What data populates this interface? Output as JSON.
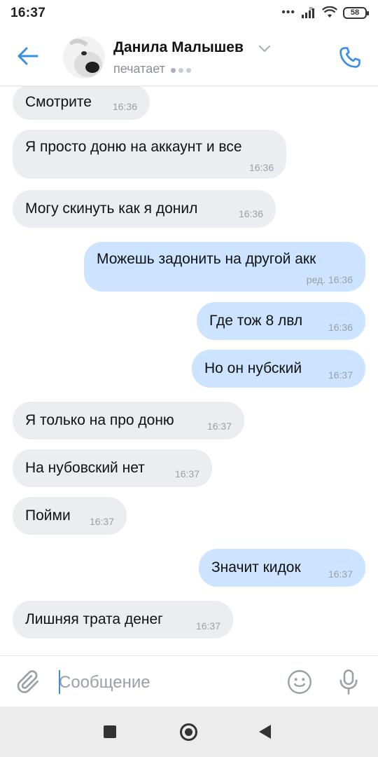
{
  "status_bar": {
    "time": "16:37",
    "battery": "58",
    "icons": [
      "dots-icon",
      "signal-icon",
      "wifi-icon",
      "battery-icon"
    ]
  },
  "header": {
    "contact_name": "Данила Малышев",
    "status": "печатает",
    "accent_color": "#3a8ee6"
  },
  "messages": [
    {
      "dir": "in",
      "text": "Смотрите",
      "time": "16:36"
    },
    {
      "dir": "in",
      "text": "Я просто доню на аккаунт и все",
      "time": "16:36"
    },
    {
      "dir": "in",
      "text": "Могу скинуть как я донил",
      "time": "16:36"
    },
    {
      "dir": "out",
      "text": "Можешь задонить на другой акк",
      "time": "ред. 16:36"
    },
    {
      "dir": "out",
      "text": "Где тож 8 лвл",
      "time": "16:36"
    },
    {
      "dir": "out",
      "text": "Но он нубский",
      "time": "16:37"
    },
    {
      "dir": "in",
      "text": "Я только на про доню",
      "time": "16:37"
    },
    {
      "dir": "in",
      "text": "На нубовский нет",
      "time": "16:37"
    },
    {
      "dir": "in",
      "text": "Пойми",
      "time": "16:37"
    },
    {
      "dir": "out",
      "text": "Значит кидок",
      "time": "16:37"
    },
    {
      "dir": "in",
      "text": "Лишняя трата денег",
      "time": "16:37"
    }
  ],
  "composer": {
    "placeholder": "Сообщение",
    "value": ""
  },
  "colors": {
    "incoming_bubble": "#ebedf0",
    "outgoing_bubble": "#cce4ff"
  }
}
